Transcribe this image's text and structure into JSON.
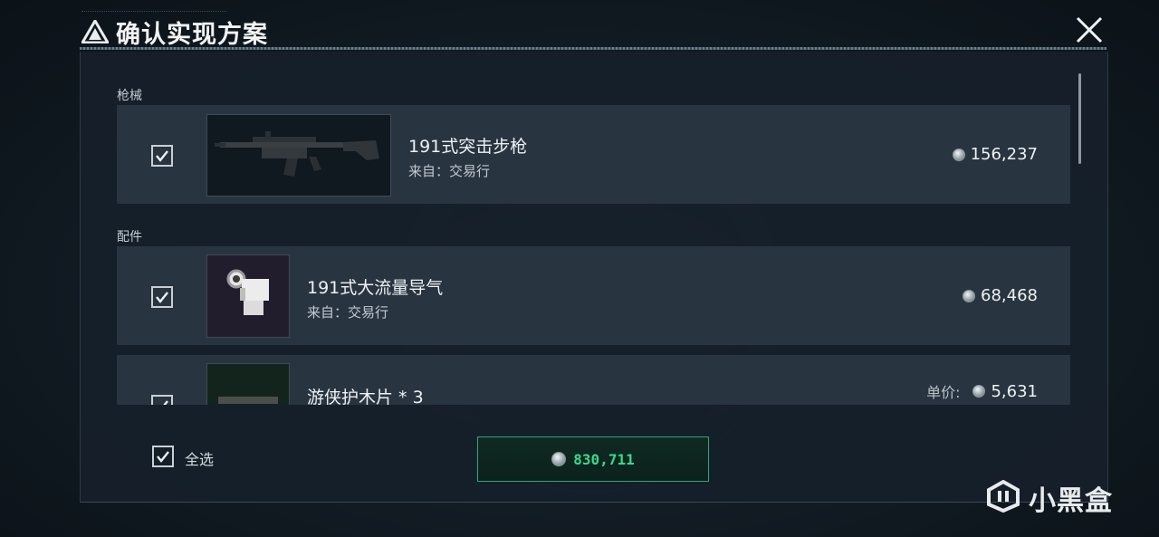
{
  "dialog": {
    "title": "确认实现方案"
  },
  "sections": {
    "guns_label": "枪械",
    "attachments_label": "配件"
  },
  "items": [
    {
      "name": "191式突击步枪",
      "source": "来自：交易行",
      "price": "156,237",
      "checked": true,
      "thumb_icon": "rifle-icon"
    },
    {
      "name": "191式大流量导气",
      "source": "来自：交易行",
      "price": "68,468",
      "checked": true,
      "thumb_icon": "gas-block-icon"
    },
    {
      "name": "游侠护木片 * 3",
      "price_label": "单价:",
      "price": "5,631",
      "checked": true,
      "thumb_icon": "handguard-panel-icon"
    }
  ],
  "footer": {
    "select_all_label": "全选",
    "select_all_checked": true,
    "total": "830,711"
  },
  "watermark": {
    "text": "小黑盒"
  },
  "colors": {
    "accent_green": "#38d98e",
    "total_border": "#2aa874"
  }
}
